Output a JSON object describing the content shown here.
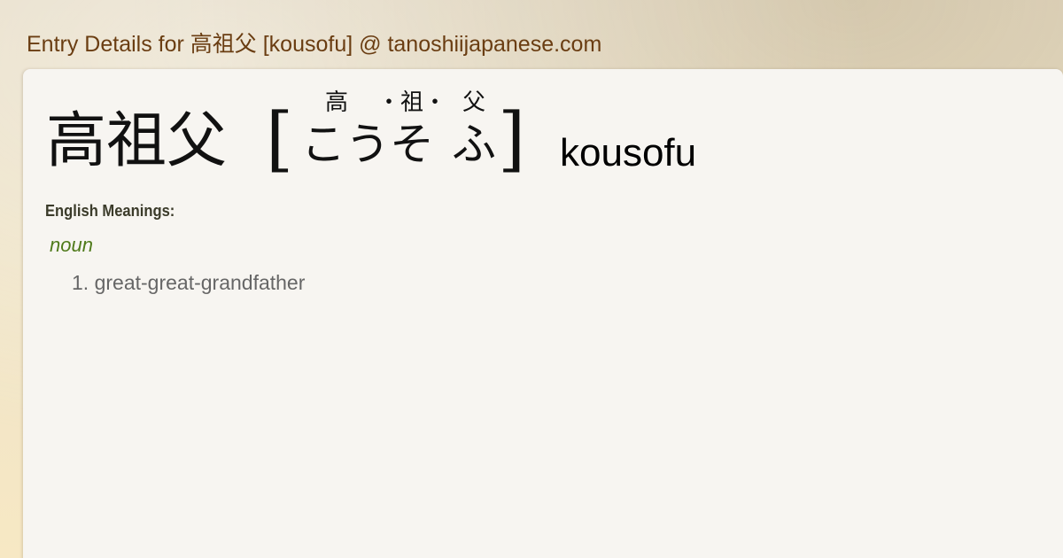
{
  "header": {
    "title": "Entry Details for 高祖父 [kousofu] @ tanoshiijapanese.com"
  },
  "entry": {
    "kanji": "高祖父",
    "bracket_open": "[",
    "bracket_close": "]",
    "furigana": [
      {
        "top": "高",
        "reading": "こう"
      },
      {
        "top": "・祖・",
        "reading": "そ"
      },
      {
        "top": "父",
        "reading": "ふ"
      }
    ],
    "romaji": "kousofu"
  },
  "meanings": {
    "heading": "English Meanings:",
    "part_of_speech": "noun",
    "items": [
      "1. great-great-grandfather"
    ]
  }
}
